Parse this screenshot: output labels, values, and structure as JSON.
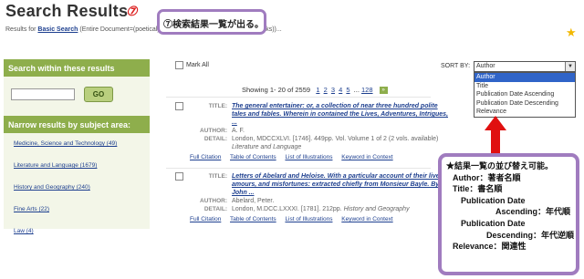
{
  "header": {
    "title": "Search Results",
    "circled_number": "⑦",
    "results_prefix": "Results for",
    "search_type": "Basic Search",
    "results_query": "(Entire Document=(poetical)) And (Entire Document=(poetical works))..."
  },
  "callout_top": "⑦検索結果一覧が出る。",
  "sidebar": {
    "search_heading": "Search within these results",
    "go_label": "GO",
    "narrow_heading": "Narrow results by subject area:",
    "subjects": [
      "Medicine, Science and Technology (49)",
      "Literature and Language (1679)",
      "History and Geography (240)",
      "Fine Arts (22)",
      "Law (4)"
    ]
  },
  "toolbar": {
    "mark_all": "Mark All",
    "sort_by": "SORT BY:",
    "sort_selected": "Author",
    "sort_options": [
      "Author",
      "Title",
      "Publication Date Ascending",
      "Publication Date Descending",
      "Relevance"
    ]
  },
  "pagination": {
    "showing": "Showing 1- 20 of 2559",
    "pages": [
      "1",
      "2",
      "3",
      "4",
      "5"
    ],
    "ellipsis": "...",
    "last_page": "128",
    "next_label": "»"
  },
  "records": [
    {
      "title_label": "TITLE:",
      "title": "The general entertainer: or, a collection of near three hundred polite tales and fables. Wherein in contained the Lives, Adventures, Intrigues, ...",
      "author_label": "AUTHOR:",
      "author": "A. F.",
      "detail_label": "DETAIL:",
      "detail": "London, MDCCXLVI. [1746]. 449pp. Vol. Volume 1 of 2 (2 vols. available)",
      "detail_italic": "Literature and Language",
      "links": [
        "Full Citation",
        "Table of Contents",
        "List of Illustrations",
        "Keyword in Context"
      ]
    },
    {
      "title_label": "TITLE:",
      "title": "Letters of Abelard and Heloise. With a particular account of their lives, amours, and misfortunes: extracted chiefly from Monsieur Bayle. By John ...",
      "author_label": "AUTHOR:",
      "author": "Abelard, Peter.",
      "detail_label": "DETAIL:",
      "detail": "London, M.DCC.LXXXI. [1781]. 212pp.",
      "detail_italic": "History and Geography",
      "links": [
        "Full Citation",
        "Table of Contents",
        "List of Illustrations",
        "Keyword in Context"
      ]
    }
  ],
  "callout_big": {
    "line1": "★結果一覧の並び替え可能。",
    "line2": "Author：著者名順",
    "line3": "Title：書名順",
    "line4": "Publication Date",
    "line5": "Ascending：年代順",
    "line6": "Publication Date",
    "line7": "Descending：年代逆順",
    "line8": "Relevance：関連性"
  },
  "colors": {
    "accent_green": "#8eae4c",
    "callout_purple": "#a07cbf",
    "arrow_red": "#e01010",
    "link_blue": "#1d3f8f",
    "selected_blue": "#3064c8"
  },
  "icons": [
    "star-icon",
    "checkbox-icon",
    "dropdown-arrow-icon",
    "next-page-icon",
    "red-up-arrow-icon",
    "toc-icon"
  ]
}
